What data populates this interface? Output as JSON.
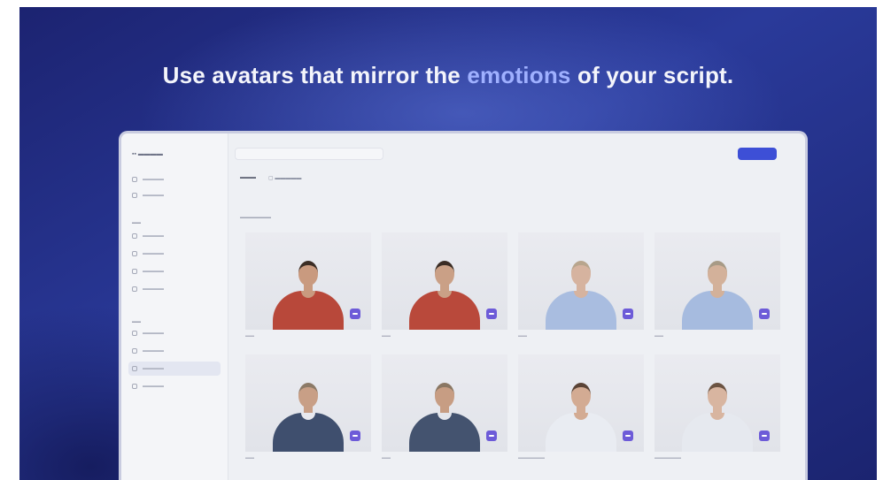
{
  "headline": {
    "prefix": "Use avatars that mirror the ",
    "accent": "emotions",
    "suffix": " of your script."
  },
  "colors": {
    "background": "#1f2878",
    "accent_text": "#9fb0ff",
    "primary_button": "#3d4fd6",
    "badge": "#6d5bd8"
  },
  "app": {
    "sidebar_nav": [
      {
        "icon": "home-icon"
      },
      {
        "icon": "templates-icon"
      },
      {
        "icon": "workspace-icon"
      },
      {
        "icon": "shared-icon"
      },
      {
        "icon": "folder-icon"
      },
      {
        "icon": "trash-icon"
      },
      {
        "icon": "library-icon"
      },
      {
        "icon": "brand-icon"
      },
      {
        "icon": "avatar-icon",
        "active": true
      },
      {
        "icon": "voice-icon"
      }
    ],
    "avatars": [
      {
        "skin": "#c99a7f",
        "hair": "#3b2d25",
        "top": "#b8483a",
        "collar": "#c99a7f"
      },
      {
        "skin": "#caa086",
        "hair": "#3a2c24",
        "top": "#b9493b",
        "collar": "#caa086"
      },
      {
        "skin": "#d6b39f",
        "hair": "#b8a58d",
        "top": "#a9bde0",
        "collar": "#d6b39f"
      },
      {
        "skin": "#d3b19a",
        "hair": "#a79a86",
        "top": "#a6bbdf",
        "collar": "#d3b19a"
      },
      {
        "skin": "#c89f86",
        "hair": "#8c7a67",
        "top": "#3f4f6e",
        "collar": "#e8e9ef"
      },
      {
        "skin": "#c79d83",
        "hair": "#8a7763",
        "top": "#44536f",
        "collar": "#e4e6ec"
      },
      {
        "skin": "#d3ab93",
        "hair": "#5a4336",
        "top": "#e9ecf2",
        "collar": "#d3ab93"
      },
      {
        "skin": "#d8b5a0",
        "hair": "#6b5342",
        "top": "#e6e9ef",
        "collar": "#d8b5a0"
      }
    ]
  }
}
